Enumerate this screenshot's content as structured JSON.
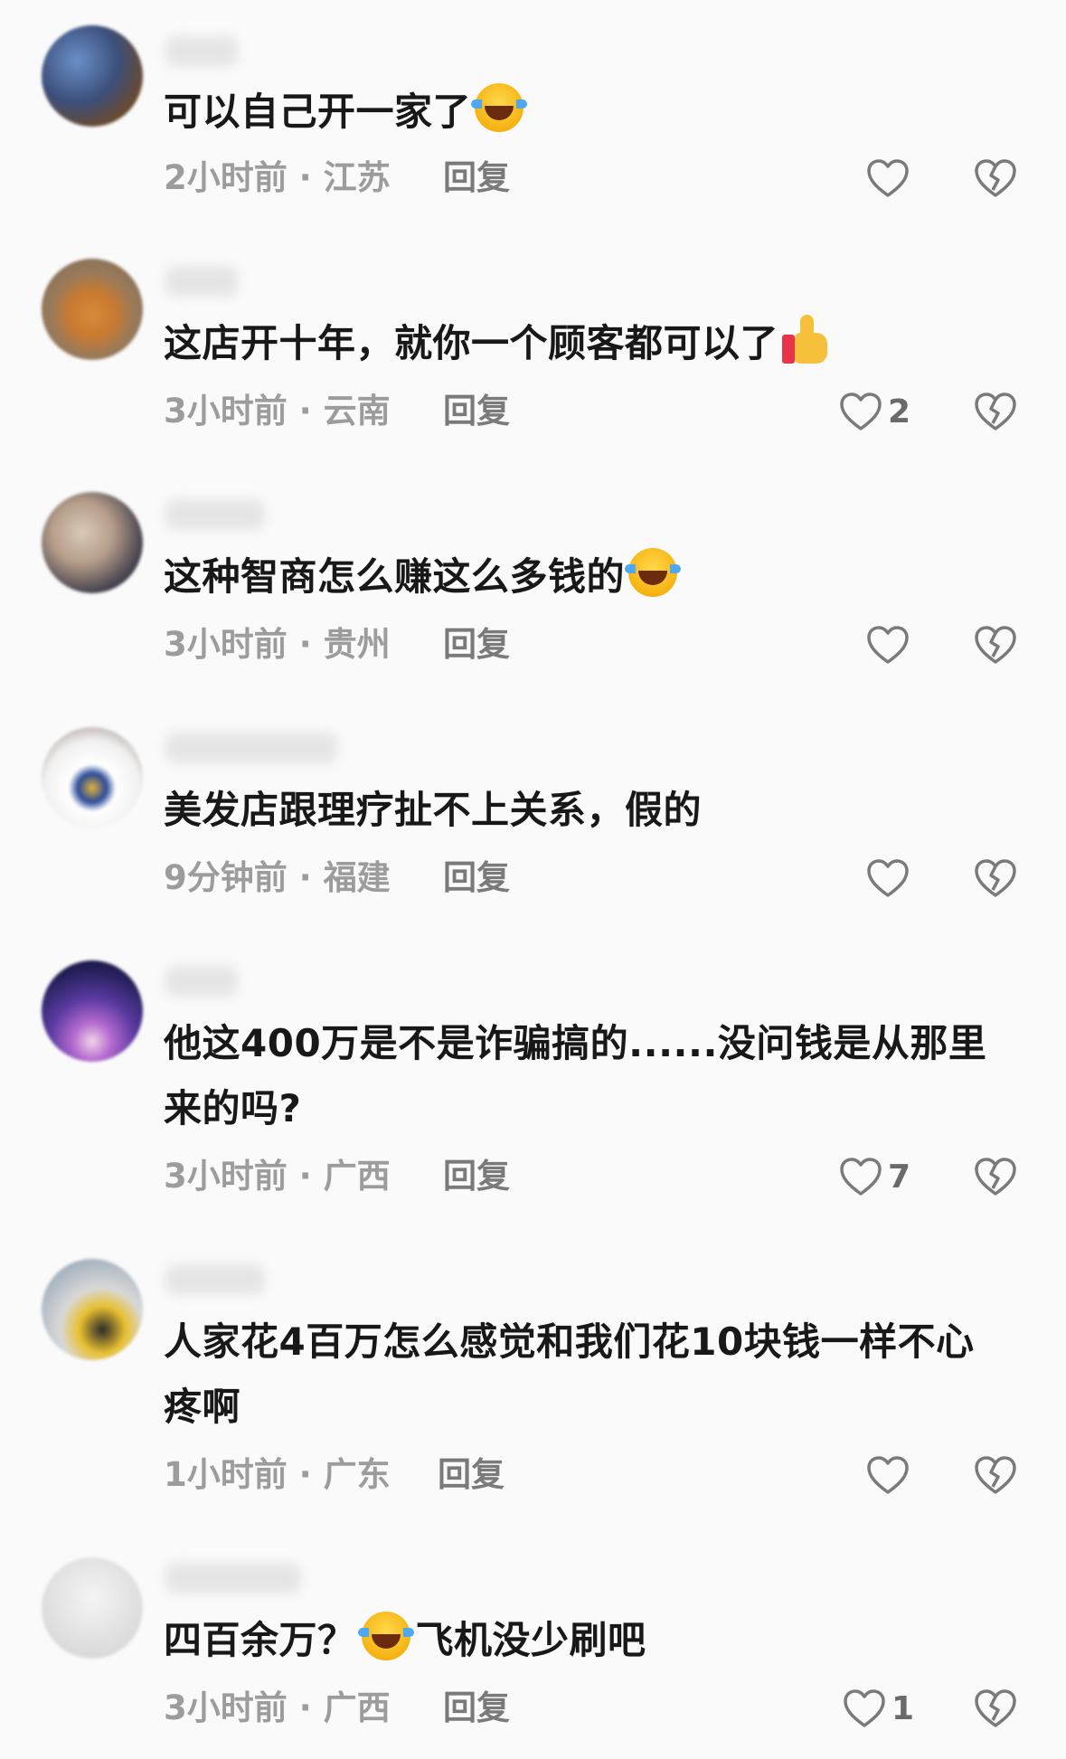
{
  "comments": [
    {
      "text": "可以自己开一家了",
      "emoji": "laughing-tears",
      "time": "2小时前 · 江苏",
      "reply": "回复",
      "likes": ""
    },
    {
      "text": "这店开十年，就你一个顾客都可以了",
      "emoji": "thumbs-up",
      "time": "3小时前 · 云南",
      "reply": "回复",
      "likes": "2"
    },
    {
      "text": "这种智商怎么赚这么多钱的",
      "emoji": "laughing-tears",
      "time": "3小时前 · 贵州",
      "reply": "回复",
      "likes": ""
    },
    {
      "text": "美发店跟理疗扯不上关系，假的",
      "emoji": "",
      "time": "9分钟前 · 福建",
      "reply": "回复",
      "likes": ""
    },
    {
      "text_line1": "他这400万是不是诈骗搞的......没问钱是从那里",
      "text_line2": "来的吗?",
      "emoji": "",
      "time": "3小时前 · 广西",
      "reply": "回复",
      "likes": "7"
    },
    {
      "text_line1": "人家花4百万怎么感觉和我们花10块钱一样不心",
      "text_line2": "疼啊",
      "emoji": "",
      "time": "1小时前 · 广东",
      "reply": "回复",
      "likes": ""
    },
    {
      "text_a": "四百余万？",
      "text_b": "飞机没少刷吧",
      "emoji": "laughing-tears",
      "time": "3小时前 · 广西",
      "reply": "回复",
      "likes": "1"
    }
  ],
  "icons": {
    "like": "heart-outline-icon",
    "dislike": "broken-heart-icon"
  },
  "colors": {
    "text": "#181818",
    "meta": "#9c9c9c",
    "icon": "#7a7a7a",
    "background": "#fafafa"
  }
}
